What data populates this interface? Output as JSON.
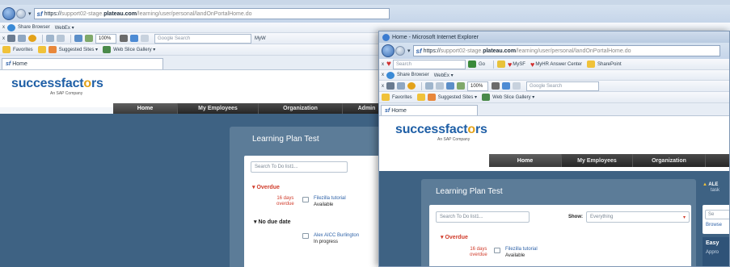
{
  "back": {
    "address": {
      "sf": "sf",
      "scheme": "https://",
      "host_pre": "support02-stage.",
      "host": "plateau.com",
      "path": "/learning/user/personal/landOnPortalHome.do"
    },
    "row2": {
      "share": "Share Browser",
      "webex": "WebEx ▾"
    },
    "row3": {
      "zoom": "100%",
      "search_placeholder": "Google Search",
      "overflow": "MyW"
    },
    "row4": {
      "favorites": "Favorites",
      "suggested": "Suggested Sites ▾",
      "webslice": "Web Slice Gallery ▾"
    },
    "tab": "Home",
    "logo": {
      "main_a": "successfact",
      "accent": "o",
      "main_b": "rs",
      "sub": "An SAP Company"
    },
    "menu": [
      "Home",
      "My Employees",
      "Organization",
      "Admin"
    ],
    "panel": {
      "title": "Learning Plan Test",
      "search_placeholder": "Search To Do list1...",
      "overdue_header": "▾ Overdue",
      "overdue_items": [
        {
          "due_days": "16 days",
          "due_label": "overdue",
          "title": "Filezilla tutorial",
          "status": "Available"
        }
      ],
      "nodue_header": "▾ No due date",
      "nodue_items": [
        {
          "title": "Alex AICC Burlington",
          "status": "In progress"
        }
      ]
    }
  },
  "front": {
    "title": "Home - Microsoft Internet Explorer",
    "address": {
      "sf": "sf",
      "scheme": "https://",
      "host_pre": "support02-stage.",
      "host": "plateau.com",
      "path": "/learning/user/personal/landOnPortalHome.do"
    },
    "row2": {
      "search_placeholder": "Search",
      "go": "Go",
      "mysf": "MySF",
      "myhr": "MyHR Answer Center",
      "sharepoint": "SharePoint"
    },
    "row3": {
      "share": "Share Browser",
      "webex": "WebEx ▾"
    },
    "row4": {
      "zoom": "100%",
      "search_placeholder": "Google Search"
    },
    "row5": {
      "favorites": "Favorites",
      "suggested": "Suggested Sites ▾",
      "webslice": "Web Slice Gallery ▾"
    },
    "tab": "Home",
    "logo": {
      "main_a": "successfact",
      "accent": "o",
      "main_b": "rs",
      "sub": "An SAP Company"
    },
    "menu": [
      "Home",
      "My Employees",
      "Organization"
    ],
    "panel": {
      "title": "Learning Plan Test",
      "search_placeholder": "Search To Do list1...",
      "show_label": "Show:",
      "show_value": "Everything",
      "overdue_header": "▾ Overdue",
      "overdue_items": [
        {
          "due_days": "16 days",
          "due_label": "overdue",
          "title": "Filezilla tutorial",
          "status": "Available"
        }
      ]
    },
    "right_panel": {
      "name": "ALE",
      "sub": "task",
      "search_placeholder": "Se",
      "browse": "Browse",
      "easy": "Easy",
      "appro": "Appro"
    }
  }
}
